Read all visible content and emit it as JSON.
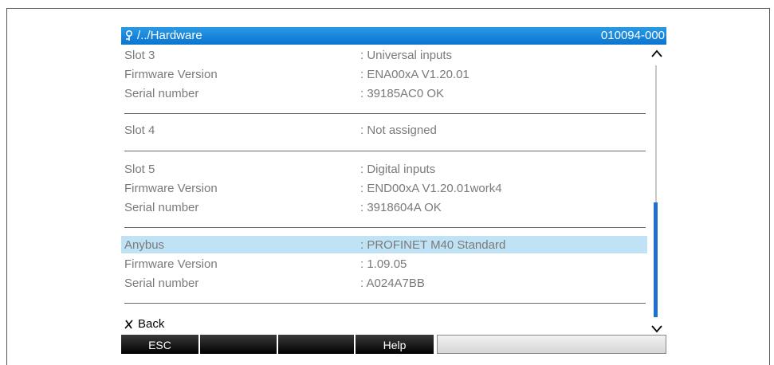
{
  "header": {
    "path": "/../Hardware",
    "code": "010094-000",
    "icon": "tree-icon"
  },
  "rows": [
    {
      "label": "Slot 3",
      "value": ": Universal inputs"
    },
    {
      "label": "Firmware Version",
      "value": ": ENA00xA V1.20.01"
    },
    {
      "label": "Serial number",
      "value": ": 39185AC0 OK"
    },
    {
      "label": "Slot 4",
      "value": ": Not assigned"
    },
    {
      "label": "Slot 5",
      "value": ": Digital inputs"
    },
    {
      "label": "Firmware Version",
      "value": ": END00xA V1.20.01work4"
    },
    {
      "label": "Serial number",
      "value": ": 3918604A OK"
    },
    {
      "label": "Anybus",
      "value": ": PROFINET M40 Standard"
    },
    {
      "label": "Firmware Version",
      "value": ": 1.09.05"
    },
    {
      "label": "Serial number",
      "value": ": A024A7BB"
    }
  ],
  "back": {
    "label": "Back",
    "icon": "close-icon"
  },
  "softkeys": {
    "esc": "ESC",
    "key2": "",
    "key3": "",
    "help": "Help",
    "key5": ""
  },
  "scrollbar": {
    "position_fraction": 0.8
  },
  "colors": {
    "header": "#0a74d0",
    "selected_row": "#bfe2f5",
    "text": "#7a7a7a",
    "thumb": "#1f6fd1"
  }
}
